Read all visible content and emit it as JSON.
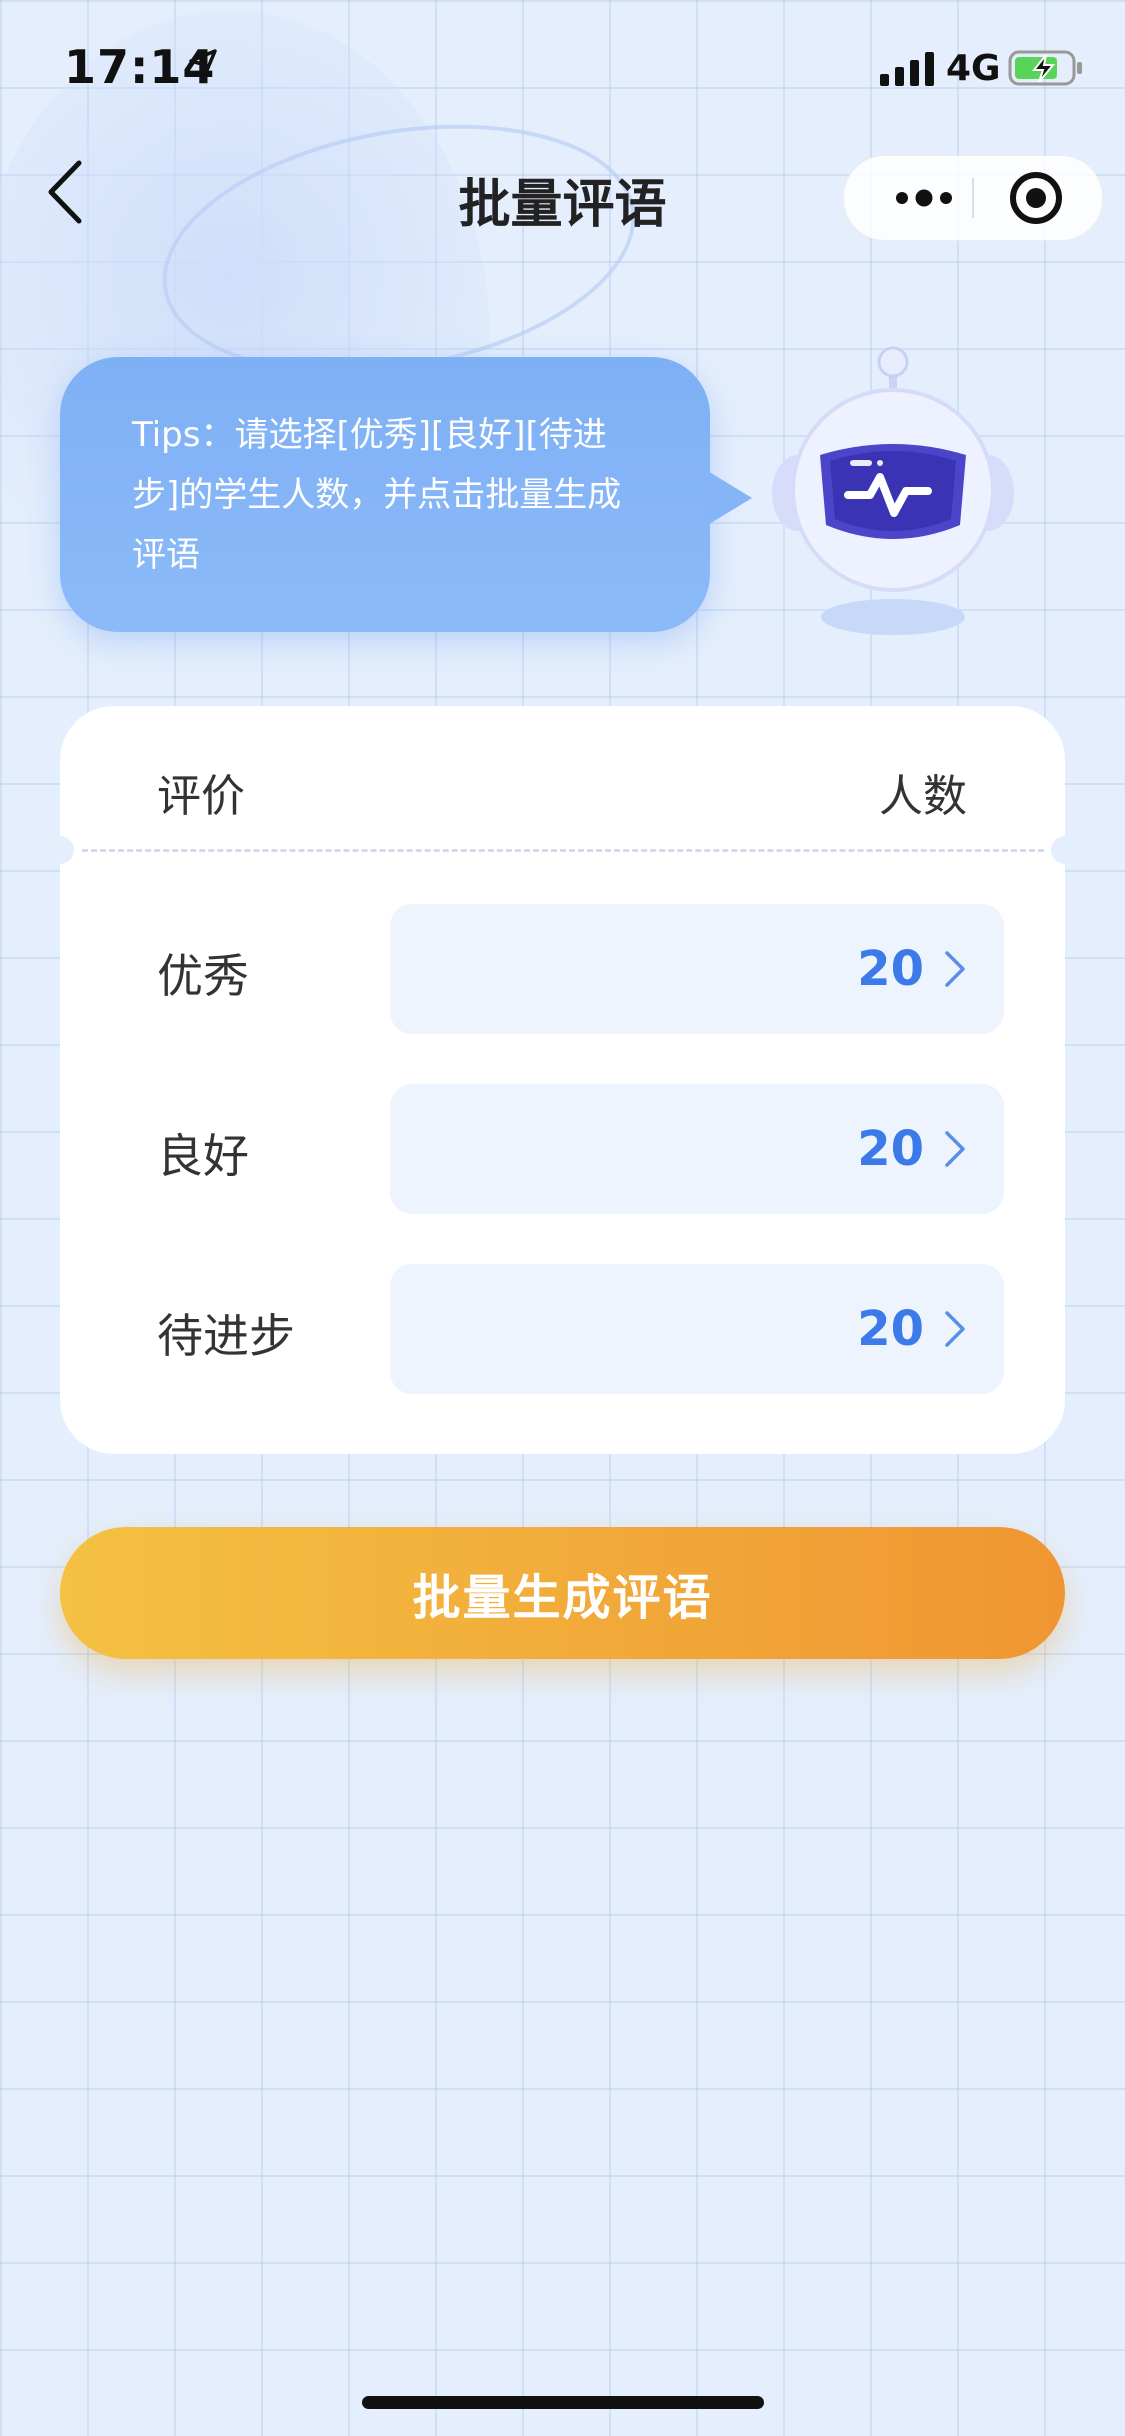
{
  "status_bar": {
    "time": "17:14",
    "network": "4G",
    "icons": [
      "location-arrow-icon",
      "signal-icon",
      "battery-charging-icon"
    ]
  },
  "nav": {
    "title": "批量评语",
    "back_icon": "chevron-left-icon",
    "more_icon": "more-dots-icon",
    "close_icon": "target-close-icon"
  },
  "tips": {
    "text": "Tips：请选择[优秀][良好][待进步]的学生人数，并点击批量生成评语"
  },
  "table": {
    "header_left": "评价",
    "header_right": "人数",
    "rows": [
      {
        "label": "优秀",
        "value": "20"
      },
      {
        "label": "良好",
        "value": "20"
      },
      {
        "label": "待进步",
        "value": "20"
      }
    ]
  },
  "actions": {
    "generate_label": "批量生成评语"
  },
  "colors": {
    "accent": "#3b7ae8",
    "button_start": "#f4c142",
    "button_end": "#ef9632",
    "tips_bg": "#86b5f7"
  }
}
